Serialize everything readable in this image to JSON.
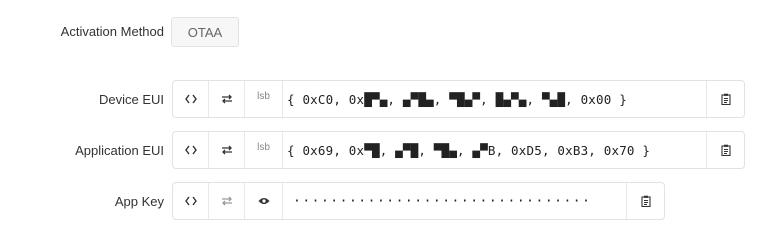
{
  "activation": {
    "label": "Activation Method",
    "value": "OTAA"
  },
  "device_eui": {
    "label": "Device EUI",
    "byte_order": "lsb",
    "value": "{ 0xC0, 0x█▀▄, ▄▀█▄, ▀█▄▀, █▄▀▄, ▀▄█, 0x00 }"
  },
  "application_eui": {
    "label": "Application EUI",
    "byte_order": "lsb",
    "value": "{ 0x69, 0x▀█, ▄▀█, ▀█▄, ▄▀B, 0xD5, 0xB3, 0x70 }"
  },
  "app_key": {
    "label": "App Key",
    "value": "································"
  },
  "icons": {
    "toggle_format": "code-brackets-icon",
    "swap_byte_order": "swap-arrows-icon",
    "show_hide": "eye-icon",
    "copy": "clipboard-icon"
  }
}
